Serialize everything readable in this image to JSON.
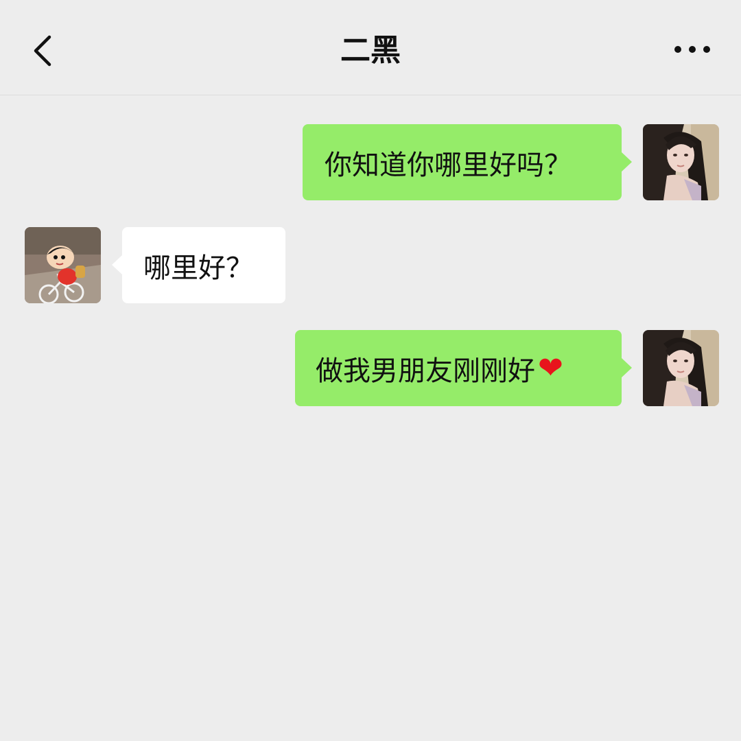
{
  "header": {
    "title": "二黑",
    "back_icon": "chevron-left-icon",
    "more_icon": "more-dots-icon"
  },
  "messages": [
    {
      "sender": "self",
      "text": "你知道你哪里好吗？",
      "avatar": "girl-photo-avatar"
    },
    {
      "sender": "other",
      "text": "哪里好？",
      "avatar": "cartoon-boy-bicycle-avatar"
    },
    {
      "sender": "self",
      "text": "做我男朋友刚刚好",
      "emoji": "❤",
      "avatar": "girl-photo-avatar"
    }
  ],
  "colors": {
    "background": "#ededed",
    "self_bubble": "#95ec69",
    "other_bubble": "#ffffff",
    "heart": "#e8141c"
  }
}
